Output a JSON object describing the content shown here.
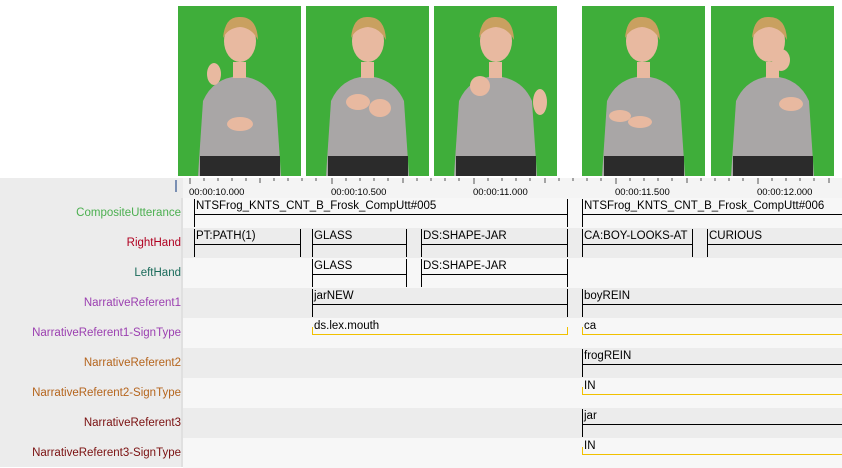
{
  "frames": [
    {
      "name": "video-frame-1"
    },
    {
      "name": "video-frame-2"
    },
    {
      "name": "video-frame-3"
    },
    {
      "name": "video-frame-4"
    },
    {
      "name": "video-frame-5"
    }
  ],
  "ruler": {
    "ticks": [
      "00:00:10.000",
      "00:00:10.500",
      "00:00:11.000",
      "00:00:11.500",
      "00:00:12.000"
    ]
  },
  "tiers": [
    {
      "label": "CompositeUtterance",
      "color": "#4caf50"
    },
    {
      "label": "RightHand",
      "color": "#b00020"
    },
    {
      "label": "LeftHand",
      "color": "#1a6b5a"
    },
    {
      "label": "NarrativeReferent1",
      "color": "#9b3fb0"
    },
    {
      "label": "NarrativeReferent1-SignType",
      "color": "#9b3fb0"
    },
    {
      "label": "NarrativeReferent2",
      "color": "#b5651d"
    },
    {
      "label": "NarrativeReferent2-SignType",
      "color": "#b5651d"
    },
    {
      "label": "NarrativeReferent3",
      "color": "#7a1010"
    },
    {
      "label": "NarrativeReferent3-SignType",
      "color": "#7a1010"
    }
  ],
  "annotations": {
    "composite_1": "NTSFrog_KNTS_CNT_B_Frosk_CompUtt#005",
    "composite_2": "NTSFrog_KNTS_CNT_B_Frosk_CompUtt#006",
    "rh_1": "PT:PATH(1)",
    "rh_2": "GLASS",
    "rh_3": "DS:SHAPE-JAR",
    "rh_4": "CA:BOY-LOOKS-AT",
    "rh_5": "CURIOUS",
    "lh_1": "GLASS",
    "lh_2": "DS:SHAPE-JAR",
    "nr1_1": "jarNEW",
    "nr1_2": "boyREIN",
    "nr1st_1": "ds.lex.mouth",
    "nr1st_2": "ca",
    "nr2_1": "frogREIN",
    "nr2st_1": "IN",
    "nr3_1": "jar",
    "nr3st_1": "IN"
  }
}
